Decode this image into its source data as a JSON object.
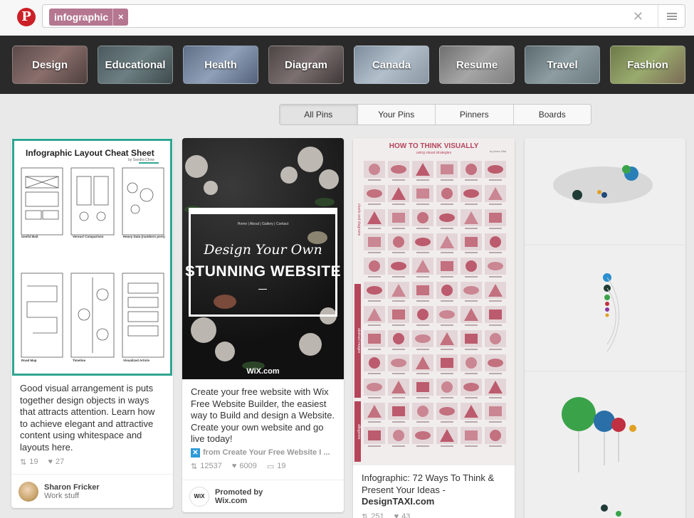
{
  "search": {
    "logo_letter": "P",
    "token_label": "infographic",
    "token_remove": "×",
    "clear": "✕"
  },
  "categories": [
    "Design",
    "Educational",
    "Health",
    "Diagram",
    "Canada",
    "Resume",
    "Travel",
    "Fashion"
  ],
  "tabs": [
    "All Pins",
    "Your Pins",
    "Pinners",
    "Boards"
  ],
  "pins": [
    {
      "image_title": "Infographic Layout Cheat Sheet",
      "image_byline": "by Sandra Chow",
      "image_sections": [
        "Useful Bait",
        "Versus/ Comparison",
        "Heavy Data (numbers porn)",
        "Road Map",
        "Timeline",
        "Visualized Article"
      ],
      "description": "Good visual arrangement is puts together design objects in ways that attracts attention. Learn how to achieve elegant and attractive content using whitespace and layouts here.",
      "repins": "19",
      "likes": "27",
      "pinner_name": "Sharon Fricker",
      "board_name": "Work stuff"
    },
    {
      "image_nav": "Home | About | Gallery | Contact",
      "image_line1": "Design Your Own",
      "image_line2": "STUNNING WEBSITE",
      "image_brand": "WiX.com",
      "description": "Create your free website with Wix Free Website Builder, the easiest way to Build and design a Website. Create your own website and go live today!",
      "source": "from Create Your Free Website I ...",
      "repins": "12537",
      "likes": "6009",
      "comments": "19",
      "promoted_label": "Promoted by",
      "promoter": "Wix.com"
    },
    {
      "image_title": "HOW TO THINK VISUALLY",
      "image_subtitle": "using visual strategies",
      "image_byline": "by Anna Vital",
      "image_side_labels": [
        "charts and diagrams",
        "abstract images",
        "allegories"
      ],
      "description_line1": "Infographic: 72 Ways To Think &",
      "description_line2": "Present Your Ideas -",
      "description_source": "DesignTAXI.com",
      "repins": "251",
      "likes": "43"
    }
  ],
  "colors": {
    "brand_red": "#cb2027",
    "token_bg": "#b5778f",
    "highlight_teal": "#2fa591",
    "visual_red": "#b5455a"
  }
}
